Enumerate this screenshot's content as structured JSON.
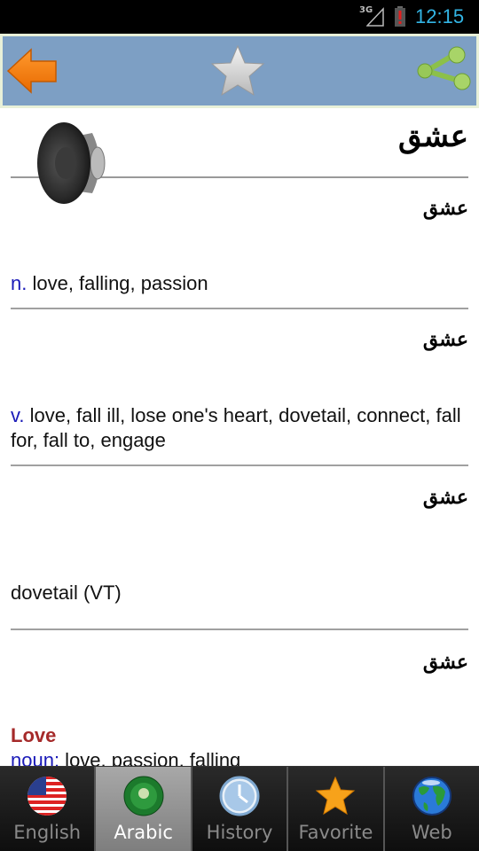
{
  "status_bar": {
    "network": "3G",
    "battery_icon": "battery-alert-icon",
    "time": "12:15",
    "time_color": "#33b5e5"
  },
  "toolbar": {
    "back_icon": "back-arrow-icon",
    "favorite_icon": "star-icon",
    "share_icon": "share-icon",
    "background_color": "#7d9fc4"
  },
  "word": {
    "headword": "عشق",
    "speaker_icon": "speaker-icon"
  },
  "entries": [
    {
      "arabic": "عشق",
      "pos": "n.",
      "definition": " love, falling, passion"
    },
    {
      "arabic": "عشق",
      "pos": "v.",
      "definition": " love, fall ill, lose one's heart, dovetail, connect, fall for, fall to, engage"
    },
    {
      "arabic": "عشق",
      "pos": "",
      "definition": "dovetail (VT)"
    },
    {
      "arabic": "عشق",
      "title": "Love",
      "pos": "noun:",
      "definition": " love, passion, falling"
    }
  ],
  "colors": {
    "pos": "#1a1ab8",
    "title": "#a52a2a"
  },
  "tabs": [
    {
      "label": "English",
      "icon": "us-flag-icon",
      "active": false
    },
    {
      "label": "Arabic",
      "icon": "arab-league-icon",
      "active": true
    },
    {
      "label": "History",
      "icon": "clock-icon",
      "active": false
    },
    {
      "label": "Favorite",
      "icon": "star-icon",
      "active": false
    },
    {
      "label": "Web",
      "icon": "globe-icon",
      "active": false
    }
  ]
}
